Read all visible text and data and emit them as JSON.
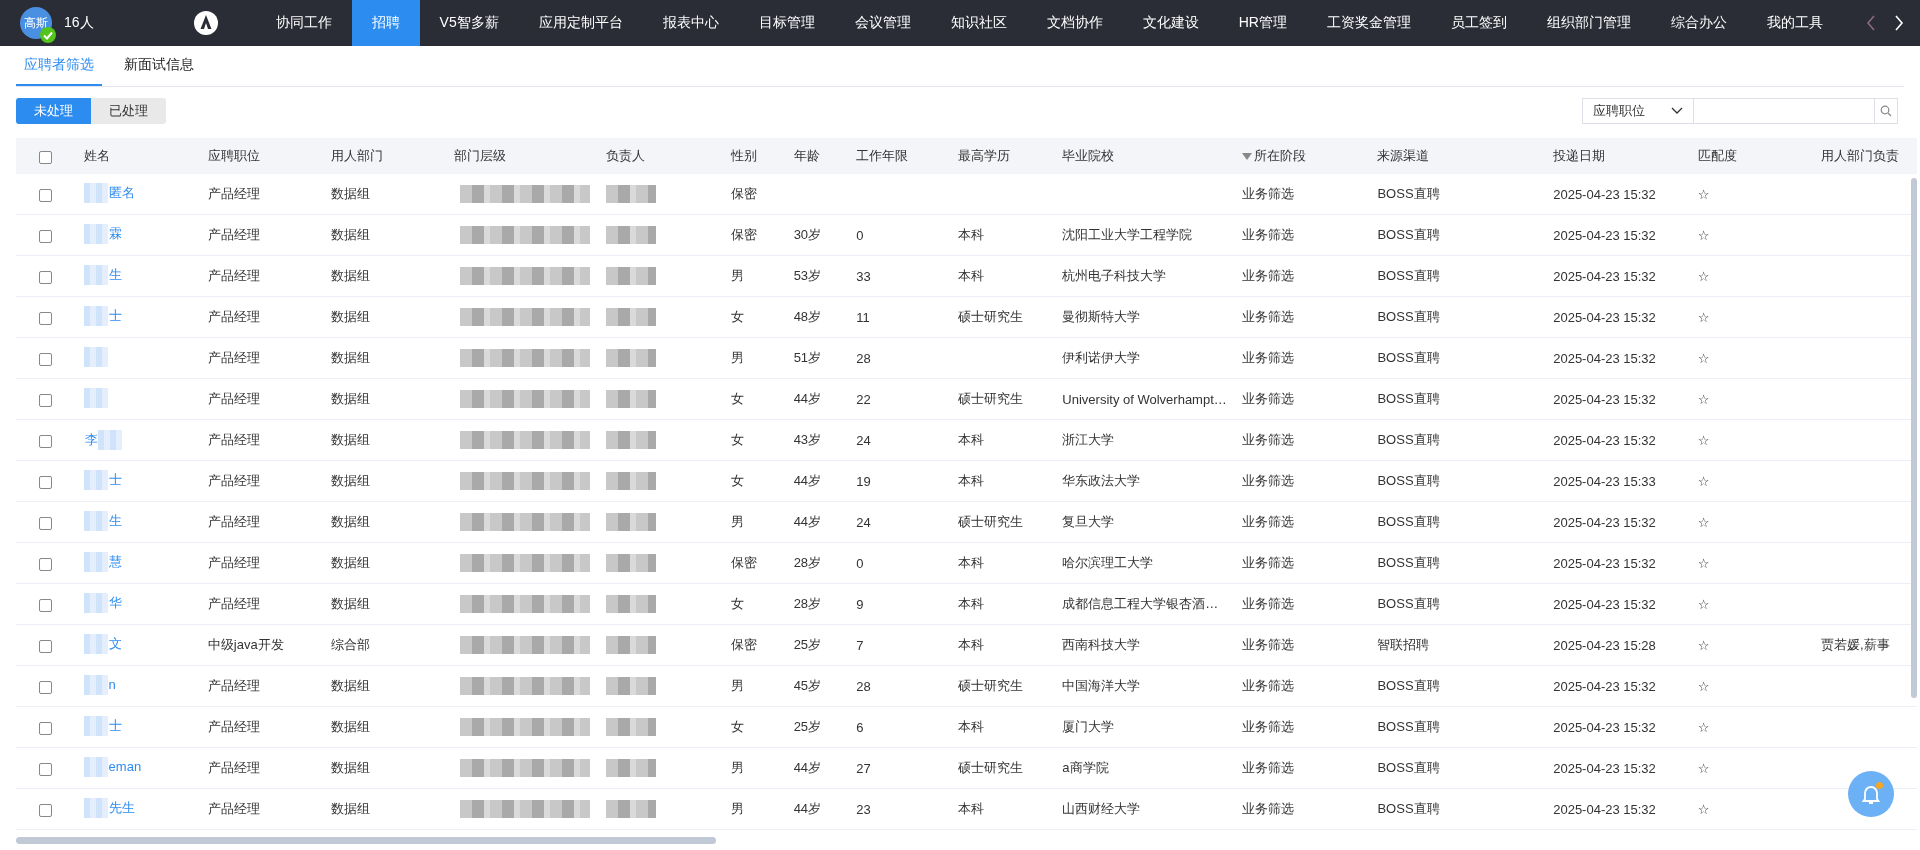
{
  "topbar": {
    "avatar_text": "高斯",
    "verified": true,
    "count": "16人",
    "nav": [
      {
        "label": "协同工作",
        "selected": false
      },
      {
        "label": "招聘",
        "selected": true
      },
      {
        "label": "V5智多薪",
        "selected": false
      },
      {
        "label": "应用定制平台",
        "selected": false
      },
      {
        "label": "报表中心",
        "selected": false
      },
      {
        "label": "目标管理",
        "selected": false
      },
      {
        "label": "会议管理",
        "selected": false
      },
      {
        "label": "知识社区",
        "selected": false
      },
      {
        "label": "文档协作",
        "selected": false
      },
      {
        "label": "文化建设",
        "selected": false
      },
      {
        "label": "HR管理",
        "selected": false
      },
      {
        "label": "工资奖金管理",
        "selected": false
      },
      {
        "label": "员工签到",
        "selected": false
      },
      {
        "label": "组织部门管理",
        "selected": false
      },
      {
        "label": "综合办公",
        "selected": false
      },
      {
        "label": "我的工具",
        "selected": false
      }
    ],
    "arrows": [
      {
        "disabled": true
      },
      {
        "disabled": false
      }
    ]
  },
  "tabs": [
    {
      "label": "应聘者筛选",
      "selected": true
    },
    {
      "label": "新面试信息",
      "selected": false
    }
  ],
  "filters": [
    {
      "label": "未处理",
      "selected": true
    },
    {
      "label": "已处理",
      "selected": false
    }
  ],
  "search": {
    "field": "应聘职位"
  },
  "table": {
    "all_checked": false,
    "columns": [
      {
        "label": "姓名",
        "kind": "name"
      },
      {
        "label": "应聘职位",
        "kind": "text"
      },
      {
        "label": "用人部门",
        "kind": "text"
      },
      {
        "label": "部门层级",
        "kind": "redacted"
      },
      {
        "label": "负责人",
        "kind": "redacted"
      },
      {
        "label": "性别",
        "kind": "text"
      },
      {
        "label": "年龄",
        "kind": "text"
      },
      {
        "label": "工作年限",
        "kind": "text"
      },
      {
        "label": "最高学历",
        "kind": "text"
      },
      {
        "label": "毕业院校",
        "kind": "text"
      },
      {
        "label": "所在阶段",
        "kind": "text",
        "sorted": true
      },
      {
        "label": "来源渠道",
        "kind": "text"
      },
      {
        "label": "投递日期",
        "kind": "text"
      },
      {
        "label": "匹配度",
        "kind": "text"
      },
      {
        "label": "用人部门负责",
        "kind": "text"
      }
    ],
    "rows": [
      {
        "checked": false,
        "cells": [
          "匿名",
          "产品经理",
          "数据组",
          "",
          "",
          "保密",
          "",
          "",
          "",
          "",
          "业务筛选",
          "BOSS直聘",
          "2025-04-23 15:32",
          "☆",
          ""
        ]
      },
      {
        "checked": false,
        "cells": [
          "霖",
          "产品经理",
          "数据组",
          "",
          "",
          "保密",
          "30岁",
          "0",
          "本科",
          "沈阳工业大学工程学院",
          "业务筛选",
          "BOSS直聘",
          "2025-04-23 15:32",
          "☆",
          ""
        ]
      },
      {
        "checked": false,
        "cells": [
          "生",
          "产品经理",
          "数据组",
          "",
          "",
          "男",
          "53岁",
          "33",
          "本科",
          "杭州电子科技大学",
          "业务筛选",
          "BOSS直聘",
          "2025-04-23 15:32",
          "☆",
          ""
        ]
      },
      {
        "checked": false,
        "cells": [
          "士",
          "产品经理",
          "数据组",
          "",
          "",
          "女",
          "48岁",
          "11",
          "硕士研究生",
          "曼彻斯特大学",
          "业务筛选",
          "BOSS直聘",
          "2025-04-23 15:32",
          "☆",
          ""
        ]
      },
      {
        "checked": false,
        "cells": [
          "",
          "产品经理",
          "数据组",
          "",
          "",
          "男",
          "51岁",
          "28",
          "",
          "伊利诺伊大学",
          "业务筛选",
          "BOSS直聘",
          "2025-04-23 15:32",
          "☆",
          ""
        ]
      },
      {
        "checked": false,
        "cells": [
          "",
          "产品经理",
          "数据组",
          "",
          "",
          "女",
          "44岁",
          "22",
          "硕士研究生",
          "University of Wolverhampt…",
          "业务筛选",
          "BOSS直聘",
          "2025-04-23 15:32",
          "☆",
          ""
        ]
      },
      {
        "checked": false,
        "mosaic_after": true,
        "cells": [
          "李",
          "产品经理",
          "数据组",
          "",
          "",
          "女",
          "43岁",
          "24",
          "本科",
          "浙江大学",
          "业务筛选",
          "BOSS直聘",
          "2025-04-23 15:32",
          "☆",
          ""
        ]
      },
      {
        "checked": false,
        "cells": [
          "士",
          "产品经理",
          "数据组",
          "",
          "",
          "女",
          "44岁",
          "19",
          "本科",
          "华东政法大学",
          "业务筛选",
          "BOSS直聘",
          "2025-04-23 15:33",
          "☆",
          ""
        ]
      },
      {
        "checked": false,
        "cells": [
          "生",
          "产品经理",
          "数据组",
          "",
          "",
          "男",
          "44岁",
          "24",
          "硕士研究生",
          "复旦大学",
          "业务筛选",
          "BOSS直聘",
          "2025-04-23 15:32",
          "☆",
          ""
        ]
      },
      {
        "checked": false,
        "cells": [
          "慧",
          "产品经理",
          "数据组",
          "",
          "",
          "保密",
          "28岁",
          "0",
          "本科",
          "哈尔滨理工大学",
          "业务筛选",
          "BOSS直聘",
          "2025-04-23 15:32",
          "☆",
          ""
        ]
      },
      {
        "checked": false,
        "cells": [
          "华",
          "产品经理",
          "数据组",
          "",
          "",
          "女",
          "28岁",
          "9",
          "本科",
          "成都信息工程大学银杏酒…",
          "业务筛选",
          "BOSS直聘",
          "2025-04-23 15:32",
          "☆",
          ""
        ]
      },
      {
        "checked": false,
        "cells": [
          "文",
          "中级java开发",
          "综合部",
          "",
          "",
          "保密",
          "25岁",
          "7",
          "本科",
          "西南科技大学",
          "业务筛选",
          "智联招聘",
          "2025-04-23 15:28",
          "☆",
          "贾若媛,薪事"
        ]
      },
      {
        "checked": false,
        "cells": [
          "n",
          "产品经理",
          "数据组",
          "",
          "",
          "男",
          "45岁",
          "28",
          "硕士研究生",
          "中国海洋大学",
          "业务筛选",
          "BOSS直聘",
          "2025-04-23 15:32",
          "☆",
          ""
        ]
      },
      {
        "checked": false,
        "cells": [
          "士",
          "产品经理",
          "数据组",
          "",
          "",
          "女",
          "25岁",
          "6",
          "本科",
          "厦门大学",
          "业务筛选",
          "BOSS直聘",
          "2025-04-23 15:32",
          "☆",
          ""
        ]
      },
      {
        "checked": false,
        "cells": [
          "eman",
          "产品经理",
          "数据组",
          "",
          "",
          "男",
          "44岁",
          "27",
          "硕士研究生",
          "a商学院",
          "业务筛选",
          "BOSS直聘",
          "2025-04-23 15:32",
          "☆",
          ""
        ]
      },
      {
        "checked": false,
        "cells": [
          "先生",
          "产品经理",
          "数据组",
          "",
          "",
          "男",
          "44岁",
          "23",
          "本科",
          "山西财经大学",
          "业务筛选",
          "BOSS直聘",
          "2025-04-23 15:32",
          "☆",
          ""
        ]
      }
    ]
  },
  "notifications": {
    "unread": true
  }
}
